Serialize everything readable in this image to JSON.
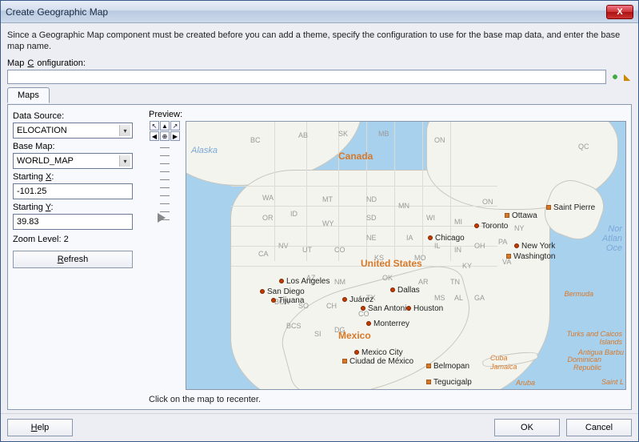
{
  "window": {
    "title": "Create Geographic Map",
    "close_label": "X"
  },
  "description": "Since a Geographic Map component must be created before you can add a theme, specify the configuration to use for the base map data, and enter the base map name.",
  "config": {
    "label_pre": "Map ",
    "label_key": "C",
    "label_post": "onfiguration:"
  },
  "tabs": {
    "maps": "Maps"
  },
  "form": {
    "data_source_label": "Data Source:",
    "data_source_value": "ELOCATION",
    "base_map_label": "Base Map:",
    "base_map_value": "WORLD_MAP",
    "starting_x_label_pre": "Starting ",
    "starting_x_key": "X",
    "starting_x_label_post": ":",
    "starting_x_value": "-101.25",
    "starting_y_label_pre": "Starting ",
    "starting_y_key": "Y",
    "starting_y_label_post": ":",
    "starting_y_value": "39.83",
    "zoom_label_pre": "Zoom Level: ",
    "zoom_value": "2",
    "refresh_key": "R",
    "refresh_post": "efresh"
  },
  "preview": {
    "label": "Preview:"
  },
  "map": {
    "countries": {
      "canada": "Canada",
      "usa": "United States",
      "mexico": "Mexico"
    },
    "sea": {
      "alaska": "Alaska",
      "north_atl1": "Nor",
      "north_atl2": "Atlan",
      "north_atl3": "Oce"
    },
    "islands": {
      "bermuda": "Bermuda",
      "tci": "Turks and Caicos Islands",
      "dr": "Dominican Republic",
      "cuba": "Cuba",
      "jamaica": "Jamaica",
      "aruba": "Aruba",
      "antigua": "Antigua Barbu",
      "saintl": "Saint L"
    },
    "states": {
      "bc": "BC",
      "ab": "AB",
      "sk": "SK",
      "mb": "MB",
      "on": "ON",
      "qc": "QC",
      "wa": "WA",
      "or": "OR",
      "ca": "CA",
      "nv": "NV",
      "id": "ID",
      "mt": "MT",
      "wy": "WY",
      "ut": "UT",
      "az": "AZ",
      "co": "CO",
      "nm": "NM",
      "nd": "ND",
      "sd": "SD",
      "ne": "NE",
      "ks": "KS",
      "ok": "OK",
      "tx": "TX",
      "mn": "MN",
      "ia": "IA",
      "mo": "MO",
      "ar": "AR",
      "wi": "WI",
      "il": "IL",
      "mi": "MI",
      "in": "IN",
      "oh": "OH",
      "ky": "KY",
      "tn": "TN",
      "ms": "MS",
      "al": "AL",
      "ga": "GA",
      "pa": "PA",
      "ny": "NY",
      "va": "VA",
      "on2": "ON",
      "bcn": "BCN",
      "bcs": "BCS",
      "so": "SO",
      "ch": "CH",
      "dg": "DG",
      "co2": "CO",
      "si": "SI"
    },
    "cities": {
      "ottawa": "Ottawa",
      "saintpierre": "Saint Pierre",
      "toronto": "Toronto",
      "chicago": "Chicago",
      "newyork": "New York",
      "washington": "Washington",
      "la": "Los Angeles",
      "sandiego": "San Diego",
      "tijuana": "Tijuana",
      "dallas": "Dallas",
      "juarez": "Juárez",
      "sanantonio": "San Antonio",
      "houston": "Houston",
      "monterrey": "Monterrey",
      "mexicocity": "Mexico City",
      "ciudad": "Ciudad de México",
      "belmopan": "Belmopan",
      "tegucigalpa": "Tegucigalp"
    }
  },
  "hint": "Click on the map to recenter.",
  "footer": {
    "help_key": "H",
    "help_post": "elp",
    "ok": "OK",
    "cancel": "Cancel"
  }
}
